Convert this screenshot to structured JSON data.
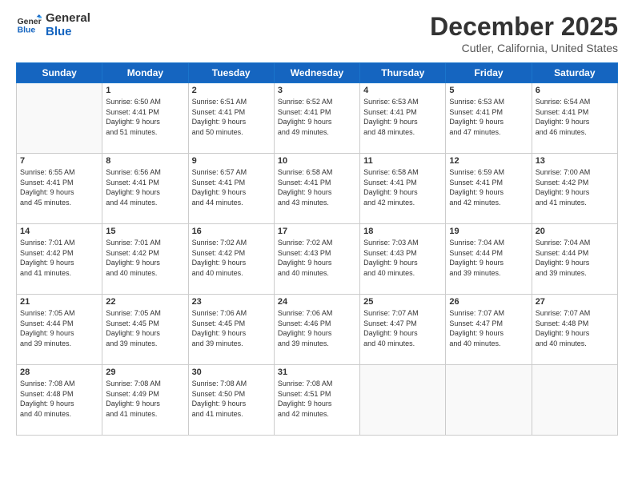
{
  "logo": {
    "line1": "General",
    "line2": "Blue"
  },
  "title": "December 2025",
  "location": "Cutler, California, United States",
  "days_of_week": [
    "Sunday",
    "Monday",
    "Tuesday",
    "Wednesday",
    "Thursday",
    "Friday",
    "Saturday"
  ],
  "weeks": [
    [
      {
        "day": "",
        "lines": []
      },
      {
        "day": "1",
        "lines": [
          "Sunrise: 6:50 AM",
          "Sunset: 4:41 PM",
          "Daylight: 9 hours",
          "and 51 minutes."
        ]
      },
      {
        "day": "2",
        "lines": [
          "Sunrise: 6:51 AM",
          "Sunset: 4:41 PM",
          "Daylight: 9 hours",
          "and 50 minutes."
        ]
      },
      {
        "day": "3",
        "lines": [
          "Sunrise: 6:52 AM",
          "Sunset: 4:41 PM",
          "Daylight: 9 hours",
          "and 49 minutes."
        ]
      },
      {
        "day": "4",
        "lines": [
          "Sunrise: 6:53 AM",
          "Sunset: 4:41 PM",
          "Daylight: 9 hours",
          "and 48 minutes."
        ]
      },
      {
        "day": "5",
        "lines": [
          "Sunrise: 6:53 AM",
          "Sunset: 4:41 PM",
          "Daylight: 9 hours",
          "and 47 minutes."
        ]
      },
      {
        "day": "6",
        "lines": [
          "Sunrise: 6:54 AM",
          "Sunset: 4:41 PM",
          "Daylight: 9 hours",
          "and 46 minutes."
        ]
      }
    ],
    [
      {
        "day": "7",
        "lines": [
          "Sunrise: 6:55 AM",
          "Sunset: 4:41 PM",
          "Daylight: 9 hours",
          "and 45 minutes."
        ]
      },
      {
        "day": "8",
        "lines": [
          "Sunrise: 6:56 AM",
          "Sunset: 4:41 PM",
          "Daylight: 9 hours",
          "and 44 minutes."
        ]
      },
      {
        "day": "9",
        "lines": [
          "Sunrise: 6:57 AM",
          "Sunset: 4:41 PM",
          "Daylight: 9 hours",
          "and 44 minutes."
        ]
      },
      {
        "day": "10",
        "lines": [
          "Sunrise: 6:58 AM",
          "Sunset: 4:41 PM",
          "Daylight: 9 hours",
          "and 43 minutes."
        ]
      },
      {
        "day": "11",
        "lines": [
          "Sunrise: 6:58 AM",
          "Sunset: 4:41 PM",
          "Daylight: 9 hours",
          "and 42 minutes."
        ]
      },
      {
        "day": "12",
        "lines": [
          "Sunrise: 6:59 AM",
          "Sunset: 4:41 PM",
          "Daylight: 9 hours",
          "and 42 minutes."
        ]
      },
      {
        "day": "13",
        "lines": [
          "Sunrise: 7:00 AM",
          "Sunset: 4:42 PM",
          "Daylight: 9 hours",
          "and 41 minutes."
        ]
      }
    ],
    [
      {
        "day": "14",
        "lines": [
          "Sunrise: 7:01 AM",
          "Sunset: 4:42 PM",
          "Daylight: 9 hours",
          "and 41 minutes."
        ]
      },
      {
        "day": "15",
        "lines": [
          "Sunrise: 7:01 AM",
          "Sunset: 4:42 PM",
          "Daylight: 9 hours",
          "and 40 minutes."
        ]
      },
      {
        "day": "16",
        "lines": [
          "Sunrise: 7:02 AM",
          "Sunset: 4:42 PM",
          "Daylight: 9 hours",
          "and 40 minutes."
        ]
      },
      {
        "day": "17",
        "lines": [
          "Sunrise: 7:02 AM",
          "Sunset: 4:43 PM",
          "Daylight: 9 hours",
          "and 40 minutes."
        ]
      },
      {
        "day": "18",
        "lines": [
          "Sunrise: 7:03 AM",
          "Sunset: 4:43 PM",
          "Daylight: 9 hours",
          "and 40 minutes."
        ]
      },
      {
        "day": "19",
        "lines": [
          "Sunrise: 7:04 AM",
          "Sunset: 4:44 PM",
          "Daylight: 9 hours",
          "and 39 minutes."
        ]
      },
      {
        "day": "20",
        "lines": [
          "Sunrise: 7:04 AM",
          "Sunset: 4:44 PM",
          "Daylight: 9 hours",
          "and 39 minutes."
        ]
      }
    ],
    [
      {
        "day": "21",
        "lines": [
          "Sunrise: 7:05 AM",
          "Sunset: 4:44 PM",
          "Daylight: 9 hours",
          "and 39 minutes."
        ]
      },
      {
        "day": "22",
        "lines": [
          "Sunrise: 7:05 AM",
          "Sunset: 4:45 PM",
          "Daylight: 9 hours",
          "and 39 minutes."
        ]
      },
      {
        "day": "23",
        "lines": [
          "Sunrise: 7:06 AM",
          "Sunset: 4:45 PM",
          "Daylight: 9 hours",
          "and 39 minutes."
        ]
      },
      {
        "day": "24",
        "lines": [
          "Sunrise: 7:06 AM",
          "Sunset: 4:46 PM",
          "Daylight: 9 hours",
          "and 39 minutes."
        ]
      },
      {
        "day": "25",
        "lines": [
          "Sunrise: 7:07 AM",
          "Sunset: 4:47 PM",
          "Daylight: 9 hours",
          "and 40 minutes."
        ]
      },
      {
        "day": "26",
        "lines": [
          "Sunrise: 7:07 AM",
          "Sunset: 4:47 PM",
          "Daylight: 9 hours",
          "and 40 minutes."
        ]
      },
      {
        "day": "27",
        "lines": [
          "Sunrise: 7:07 AM",
          "Sunset: 4:48 PM",
          "Daylight: 9 hours",
          "and 40 minutes."
        ]
      }
    ],
    [
      {
        "day": "28",
        "lines": [
          "Sunrise: 7:08 AM",
          "Sunset: 4:48 PM",
          "Daylight: 9 hours",
          "and 40 minutes."
        ]
      },
      {
        "day": "29",
        "lines": [
          "Sunrise: 7:08 AM",
          "Sunset: 4:49 PM",
          "Daylight: 9 hours",
          "and 41 minutes."
        ]
      },
      {
        "day": "30",
        "lines": [
          "Sunrise: 7:08 AM",
          "Sunset: 4:50 PM",
          "Daylight: 9 hours",
          "and 41 minutes."
        ]
      },
      {
        "day": "31",
        "lines": [
          "Sunrise: 7:08 AM",
          "Sunset: 4:51 PM",
          "Daylight: 9 hours",
          "and 42 minutes."
        ]
      },
      {
        "day": "",
        "lines": []
      },
      {
        "day": "",
        "lines": []
      },
      {
        "day": "",
        "lines": []
      }
    ]
  ]
}
